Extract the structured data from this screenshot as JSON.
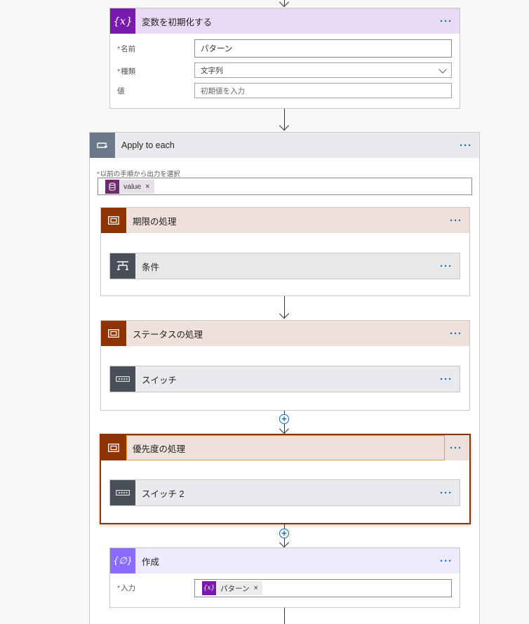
{
  "init_variable": {
    "title": "変数を初期化する",
    "name_label": "名前",
    "name_value": "パターン",
    "type_label": "種類",
    "type_value": "文字列",
    "value_label": "値",
    "value_placeholder": "初期値を入力",
    "icon": "variable-icon",
    "color": "#7719aa"
  },
  "apply_to_each": {
    "title": "Apply to each",
    "select_label": "以前の手順から出力を選択",
    "token_label": "value",
    "icon": "loop-icon",
    "color": "#6b7989"
  },
  "scope_deadline": {
    "title": "期限の処理",
    "inner_title": "条件",
    "icon": "scope-icon",
    "color": "#8f3300"
  },
  "scope_status": {
    "title": "ステータスの処理",
    "inner_title": "スイッチ",
    "icon": "scope-icon"
  },
  "scope_priority": {
    "title": "優先度の処理",
    "inner_title": "スイッチ 2",
    "icon": "scope-icon"
  },
  "compose": {
    "title": "作成",
    "input_label": "入力",
    "token_label": "パターン",
    "icon": "compose-icon",
    "color": "#8c6cff"
  },
  "more_label": "···",
  "remove_label": "×",
  "required_mark": "*",
  "add_label": "+"
}
